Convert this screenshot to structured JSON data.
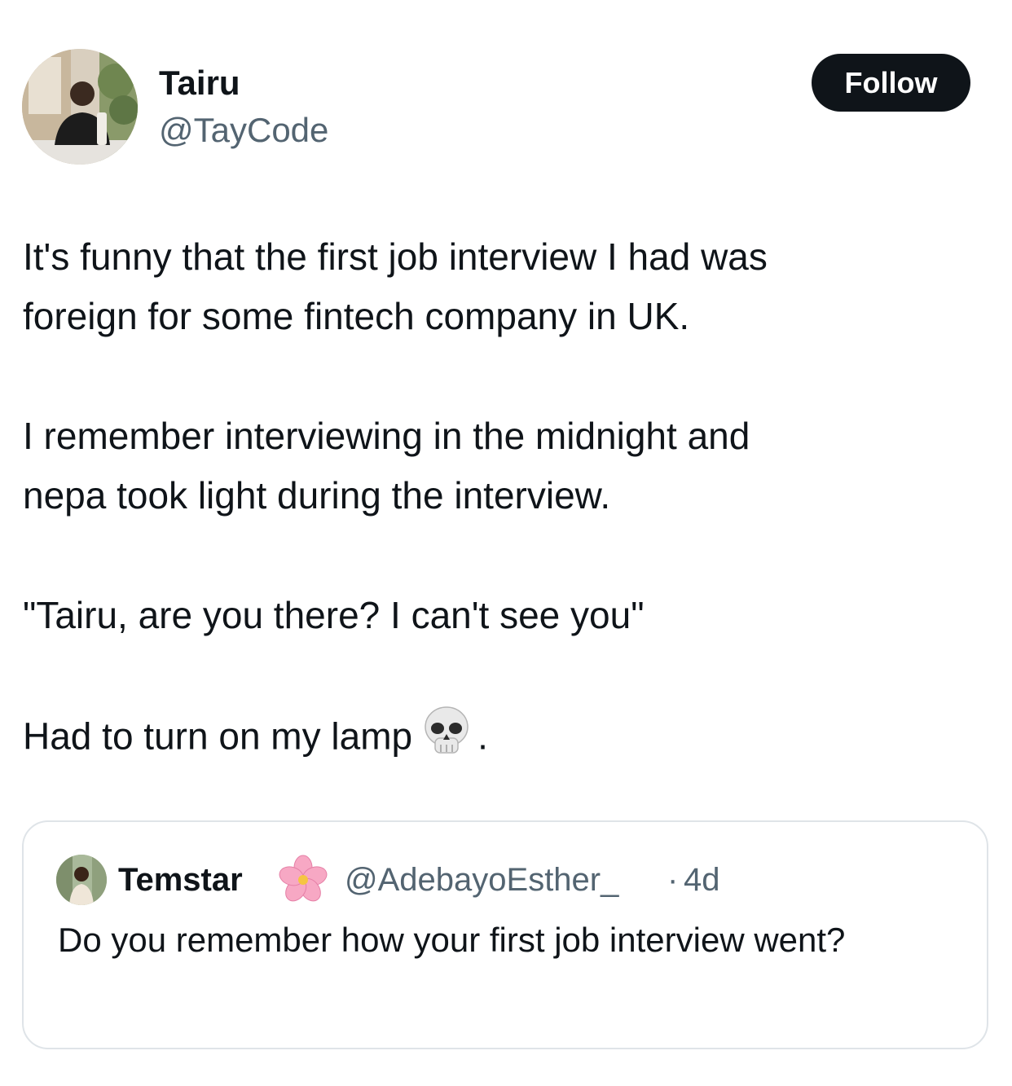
{
  "author": {
    "display_name": "Tairu",
    "handle": "@TayCode"
  },
  "follow_label": "Follow",
  "body": {
    "paragraphs": [
      [
        "It's funny that the first job interview I had was",
        "foreign for some fintech company in UK."
      ],
      [
        "I remember interviewing in the midnight and",
        "nepa took light during the interview."
      ],
      [
        "\"Tairu, are you there? I can't see you\""
      ]
    ],
    "last_line_text": "Had to turn on my lamp",
    "last_line_emoji": "skull-emoji",
    "last_line_end": "."
  },
  "quoted": {
    "display_name": "Temstar",
    "name_emoji": "cherry-blossom-emoji",
    "handle": "@AdebayoEsther_",
    "separator": "·",
    "time": "4d",
    "text": "Do you remember how your first job interview went?"
  },
  "colors": {
    "text": "#0f1419",
    "secondary": "#536471",
    "button_bg": "#0f1419",
    "border": "#dfe4e8"
  }
}
